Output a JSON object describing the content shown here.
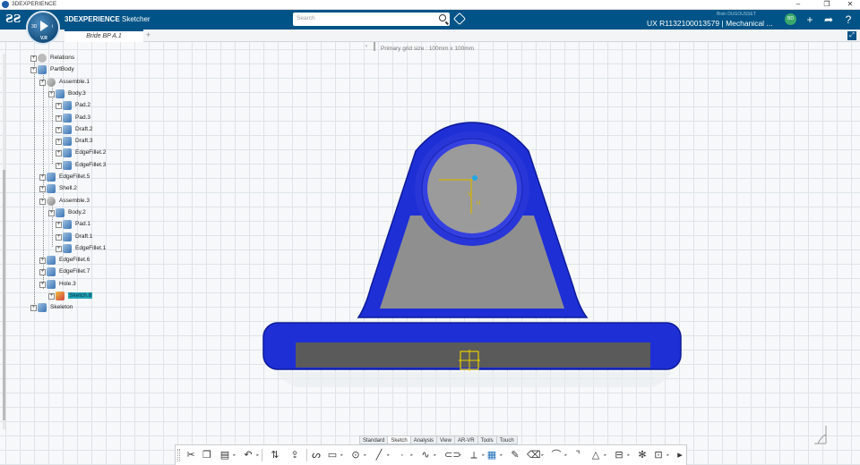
{
  "os_window": {
    "title": "3DEXPERIENCE",
    "minimize": "–",
    "maximize": "❐",
    "close": "✕"
  },
  "header": {
    "brand": "3D",
    "app_name_bold": "3DEXPERIENCE",
    "app_name_rest": " Sketcher",
    "search_placeholder": "Search",
    "user_name": "Bixin DUGOUSSET",
    "model_id": "UX R1132100013579 | Mechanical ...",
    "avatar_initials": "BD"
  },
  "compass": {
    "version": "V.R"
  },
  "tabs": [
    {
      "label": "Bride BP A.1"
    }
  ],
  "viewport": {
    "grid_info": "Primary grid size : 100mm x 100mm"
  },
  "tree": [
    {
      "label": "Relations",
      "level": 0
    },
    {
      "label": "PartBody",
      "level": 0
    },
    {
      "label": "Assemble.1",
      "level": 1
    },
    {
      "label": "Body.3",
      "level": 2
    },
    {
      "label": "Pad.2",
      "level": 3
    },
    {
      "label": "Pad.3",
      "level": 3
    },
    {
      "label": "Draft.2",
      "level": 3
    },
    {
      "label": "Draft.3",
      "level": 3
    },
    {
      "label": "EdgeFillet.2",
      "level": 3
    },
    {
      "label": "EdgeFillet.3",
      "level": 3
    },
    {
      "label": "EdgeFillet.5",
      "level": 1
    },
    {
      "label": "Shell.2",
      "level": 1
    },
    {
      "label": "Assemble.3",
      "level": 1
    },
    {
      "label": "Body.2",
      "level": 2
    },
    {
      "label": "Pad.1",
      "level": 3
    },
    {
      "label": "Draft.1",
      "level": 3
    },
    {
      "label": "EdgeFillet.1",
      "level": 3
    },
    {
      "label": "EdgeFillet.6",
      "level": 1
    },
    {
      "label": "EdgeFillet.7",
      "level": 1
    },
    {
      "label": "Hole.3",
      "level": 1
    },
    {
      "label": "Sketch.8",
      "level": 2,
      "selected": true
    },
    {
      "label": "Skeleton",
      "level": 0
    }
  ],
  "workbench_tabs": [
    "Standard",
    "Sketch",
    "Analysis",
    "View",
    "AR-VR",
    "Tools",
    "Touch"
  ],
  "active_workbench": "Sketch",
  "colors": {
    "header": "#005386",
    "part_shell": "#1f2fd6",
    "part_face": "#9a9a9a",
    "selection": "#22a6b8"
  }
}
